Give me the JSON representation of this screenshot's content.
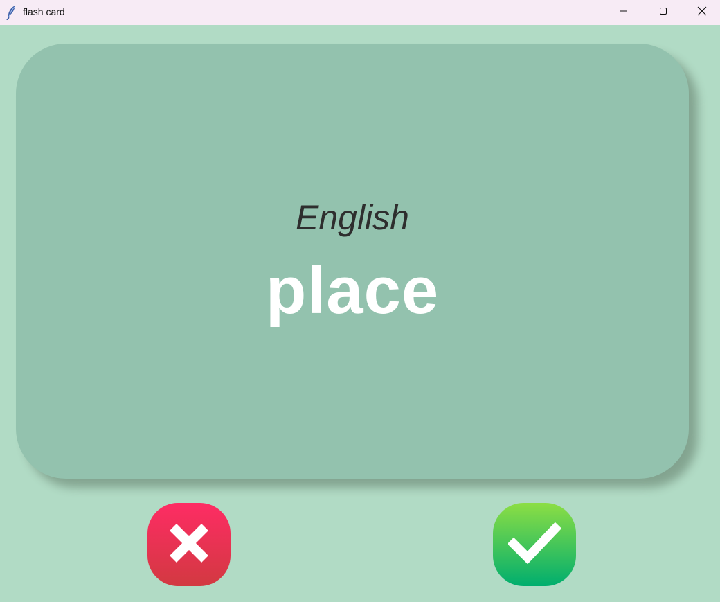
{
  "window": {
    "title": "flash card",
    "icon": "feather-icon",
    "controls": [
      "minimize-icon",
      "maximize-icon",
      "close-icon"
    ]
  },
  "card": {
    "language": "English",
    "word": "place"
  },
  "buttons": {
    "wrong": {
      "icon": "cross-icon",
      "color": "#fe2c64"
    },
    "right": {
      "icon": "checkmark-icon",
      "color": "#00ae6e"
    }
  },
  "colors": {
    "background": "#b1dbc5",
    "card": "#93c2ae",
    "titlebar": "#f7ebf5"
  }
}
